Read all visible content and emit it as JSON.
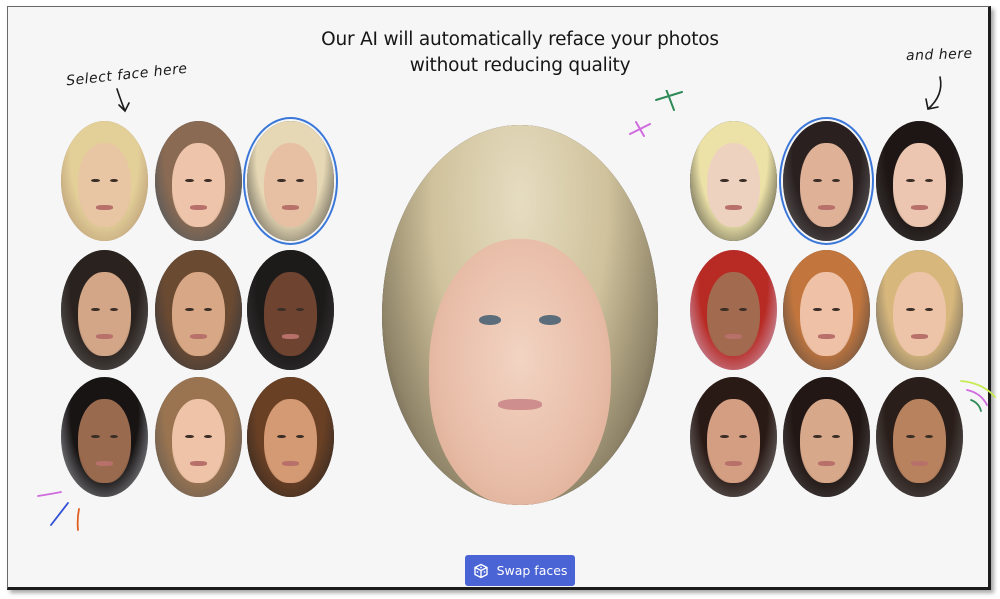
{
  "headline": "Our AI will automatically reface your photos without reducing quality",
  "annotations": {
    "left": "Select face here",
    "right": "and here"
  },
  "left_faces": [
    {
      "id": "source-face-1",
      "selected": false
    },
    {
      "id": "source-face-2",
      "selected": false
    },
    {
      "id": "source-face-3",
      "selected": true
    },
    {
      "id": "source-face-4",
      "selected": false
    },
    {
      "id": "source-face-5",
      "selected": false
    },
    {
      "id": "source-face-6",
      "selected": false
    },
    {
      "id": "source-face-7",
      "selected": false
    },
    {
      "id": "source-face-8",
      "selected": false
    },
    {
      "id": "source-face-9",
      "selected": false
    }
  ],
  "right_faces": [
    {
      "id": "target-face-1",
      "selected": false
    },
    {
      "id": "target-face-2",
      "selected": true
    },
    {
      "id": "target-face-3",
      "selected": false
    },
    {
      "id": "target-face-4",
      "selected": false
    },
    {
      "id": "target-face-5",
      "selected": false
    },
    {
      "id": "target-face-6",
      "selected": false
    },
    {
      "id": "target-face-7",
      "selected": false
    },
    {
      "id": "target-face-8",
      "selected": false
    },
    {
      "id": "target-face-9",
      "selected": false
    }
  ],
  "result": {
    "label": "swapped-face-preview"
  },
  "button": {
    "label": "Swap faces",
    "icon": "dice-icon"
  },
  "colors": {
    "accent": "#4a63d5",
    "selection_ring": "#3a77d8",
    "background": "#f6f6f6"
  }
}
